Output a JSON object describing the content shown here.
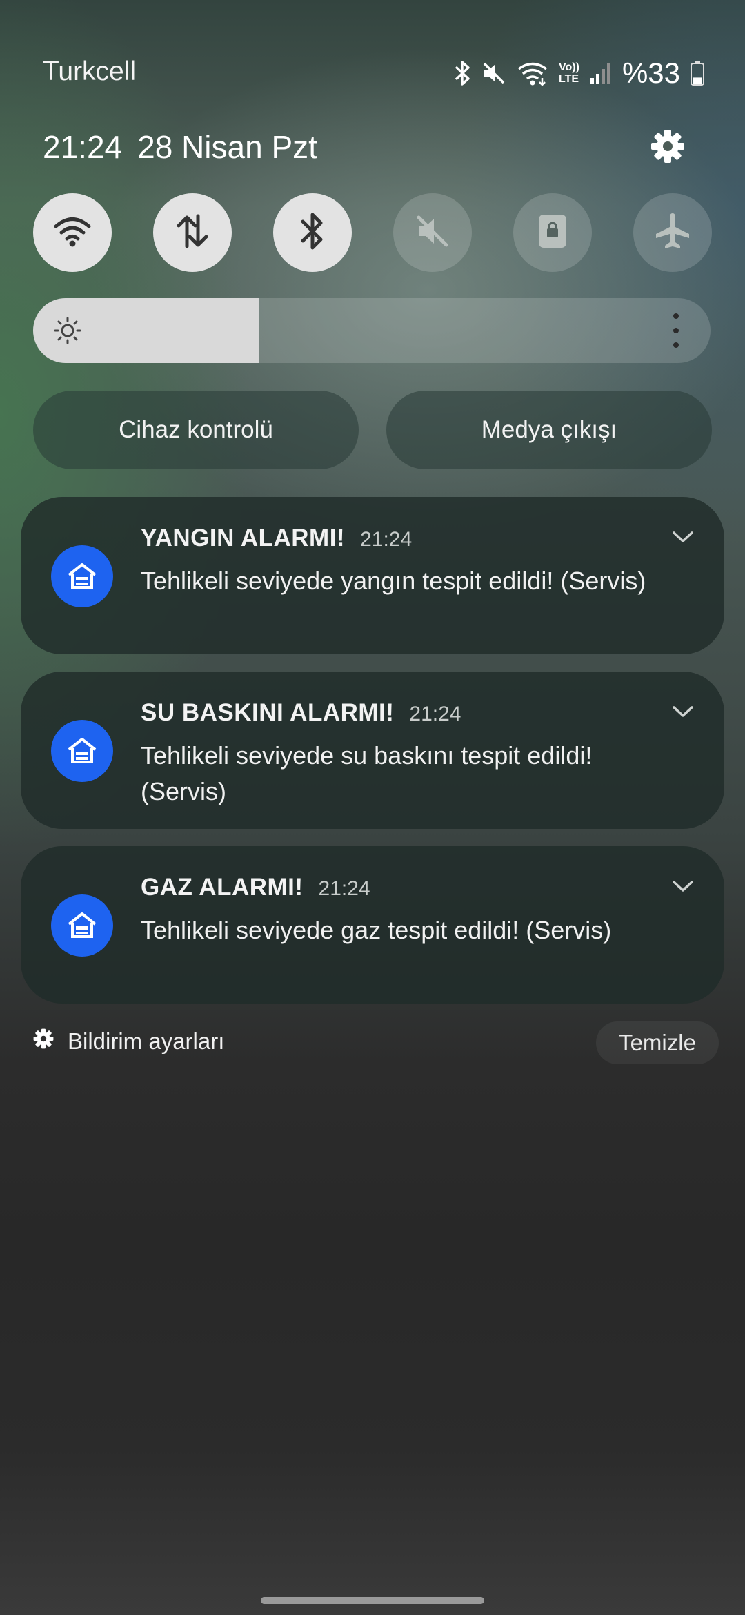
{
  "status_bar": {
    "carrier": "Turkcell",
    "battery_text": "%33",
    "icons": [
      "bluetooth-icon",
      "mute-icon",
      "wifi-icon",
      "volte-lte-icon",
      "signal-icon",
      "battery-icon"
    ],
    "volte_label_top": "Vo))",
    "volte_label_bottom": "LTE",
    "battery_level": 0.33
  },
  "header": {
    "time": "21:24",
    "date": "28 Nisan Pzt"
  },
  "quick_settings": [
    {
      "name": "wifi",
      "icon": "wifi-icon",
      "state": "on"
    },
    {
      "name": "mobile-data",
      "icon": "data-transfer-icon",
      "state": "on"
    },
    {
      "name": "bluetooth",
      "icon": "bluetooth-icon",
      "state": "on"
    },
    {
      "name": "sound",
      "icon": "mute-icon",
      "state": "off"
    },
    {
      "name": "rotation-lock",
      "icon": "lock-icon",
      "state": "off"
    },
    {
      "name": "airplane-mode",
      "icon": "airplane-icon",
      "state": "off"
    }
  ],
  "brightness": {
    "level": 0.333
  },
  "buttons": {
    "device_control": "Cihaz kontrolü",
    "media_output": "Medya çıkışı"
  },
  "notifications": [
    {
      "title": "YANGIN ALARMI!",
      "time": "21:24",
      "body": "Tehlikeli seviyede yangın tespit edildi! (Servis)"
    },
    {
      "title": "SU BASKINI ALARMI!",
      "time": "21:24",
      "body": "Tehlikeli seviyede su baskını tespit edildi! (Servis)"
    },
    {
      "title": "GAZ ALARMI!",
      "time": "21:24",
      "body": "Tehlikeli seviyede gaz tespit edildi! (Servis)"
    }
  ],
  "footer": {
    "notification_settings": "Bildirim ayarları",
    "clear": "Temizle"
  },
  "colors": {
    "app_icon_bg": "#1e63f0",
    "tile_on": "#e3e3e3",
    "notification_bg": "#202c2a"
  }
}
